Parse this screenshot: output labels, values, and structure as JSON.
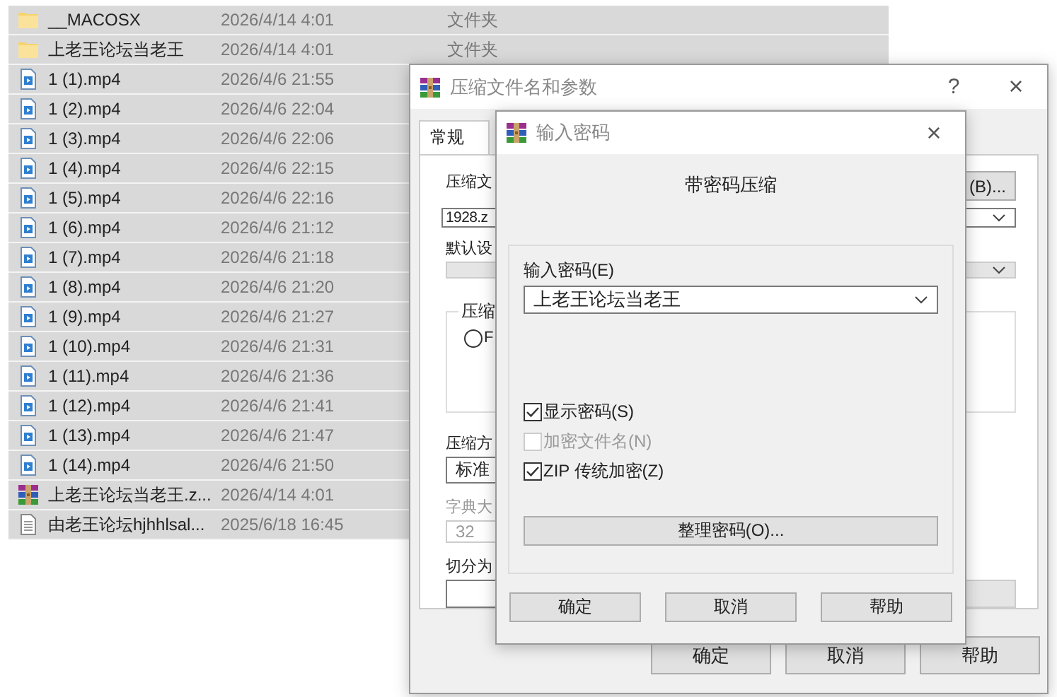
{
  "file_list": {
    "rows": [
      {
        "kind": "folder",
        "name": "__MACOSX",
        "date": "2026/4/14 4:01",
        "type": "文件夹"
      },
      {
        "kind": "folder",
        "name": "上老王论坛当老王",
        "date": "2026/4/14 4:01",
        "type": "文件夹"
      },
      {
        "kind": "video",
        "name": "1 (1).mp4",
        "date": "2026/4/6 21:55"
      },
      {
        "kind": "video",
        "name": "1 (2).mp4",
        "date": "2026/4/6 22:04"
      },
      {
        "kind": "video",
        "name": "1 (3).mp4",
        "date": "2026/4/6 22:06"
      },
      {
        "kind": "video",
        "name": "1 (4).mp4",
        "date": "2026/4/6 22:15"
      },
      {
        "kind": "video",
        "name": "1 (5).mp4",
        "date": "2026/4/6 22:16"
      },
      {
        "kind": "video",
        "name": "1 (6).mp4",
        "date": "2026/4/6 21:12"
      },
      {
        "kind": "video",
        "name": "1 (7).mp4",
        "date": "2026/4/6 21:18"
      },
      {
        "kind": "video",
        "name": "1 (8).mp4",
        "date": "2026/4/6 21:20"
      },
      {
        "kind": "video",
        "name": "1 (9).mp4",
        "date": "2026/4/6 21:27"
      },
      {
        "kind": "video",
        "name": "1 (10).mp4",
        "date": "2026/4/6 21:31"
      },
      {
        "kind": "video",
        "name": "1 (11).mp4",
        "date": "2026/4/6 21:36"
      },
      {
        "kind": "video",
        "name": "1 (12).mp4",
        "date": "2026/4/6 21:41"
      },
      {
        "kind": "video",
        "name": "1 (13).mp4",
        "date": "2026/4/6 21:47"
      },
      {
        "kind": "video",
        "name": "1 (14).mp4",
        "date": "2026/4/6 21:50"
      },
      {
        "kind": "archive",
        "name": "上老王论坛当老王.z...",
        "date": "2026/4/14 4:01"
      },
      {
        "kind": "text",
        "name": "由老王论坛hjhhlsal...",
        "date": "2025/6/18 16:45"
      }
    ]
  },
  "archive_dialog": {
    "title": "压缩文件名和参数",
    "help_button": "?",
    "close_button": "×",
    "tabs": [
      {
        "label": "常规",
        "selected": true
      }
    ],
    "archive_name_label": "压缩文",
    "browse_button": "(B)...",
    "archive_name_value": "1928.z",
    "profile_label": "默认设",
    "format_group_title": "压缩",
    "format_option": {
      "label": "F",
      "selected": false
    },
    "method_label": "压缩方",
    "method_value": "标准",
    "dictionary": {
      "label": "字典大",
      "value": "32",
      "disabled": true
    },
    "split_label": "切分为",
    "buttons": [
      "确定",
      "取消",
      "帮助"
    ]
  },
  "password_dialog": {
    "title": "输入密码",
    "close_button": "×",
    "heading": "带密码压缩",
    "password_label": "输入密码(E)",
    "password_value": "上老王论坛当老王",
    "options": [
      {
        "label": "显示密码(S)",
        "checked": true,
        "disabled": false
      },
      {
        "label": "加密文件名(N)",
        "checked": false,
        "disabled": true
      },
      {
        "label": "ZIP 传统加密(Z)",
        "checked": true,
        "disabled": false
      }
    ],
    "organize_button": "整理密码(O)...",
    "buttons": [
      "确定",
      "取消",
      "帮助"
    ]
  }
}
